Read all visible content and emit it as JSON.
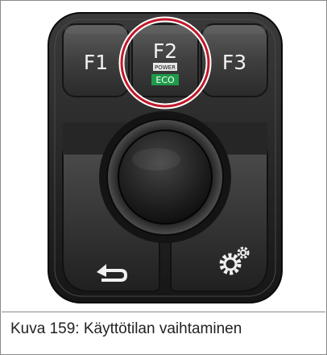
{
  "caption": "Kuva 159: Käyttötilan vaihtaminen",
  "keypad": {
    "keys": {
      "f1": "F1",
      "f2": "F2",
      "f3": "F3"
    },
    "f2_mode_labels": {
      "power": "POWER",
      "eco": "ECO"
    },
    "icons": {
      "back": "back-arrow-icon",
      "settings": "gears-icon"
    },
    "highlight_color": "#c0182a",
    "eco_color": "#1e9a4a"
  }
}
